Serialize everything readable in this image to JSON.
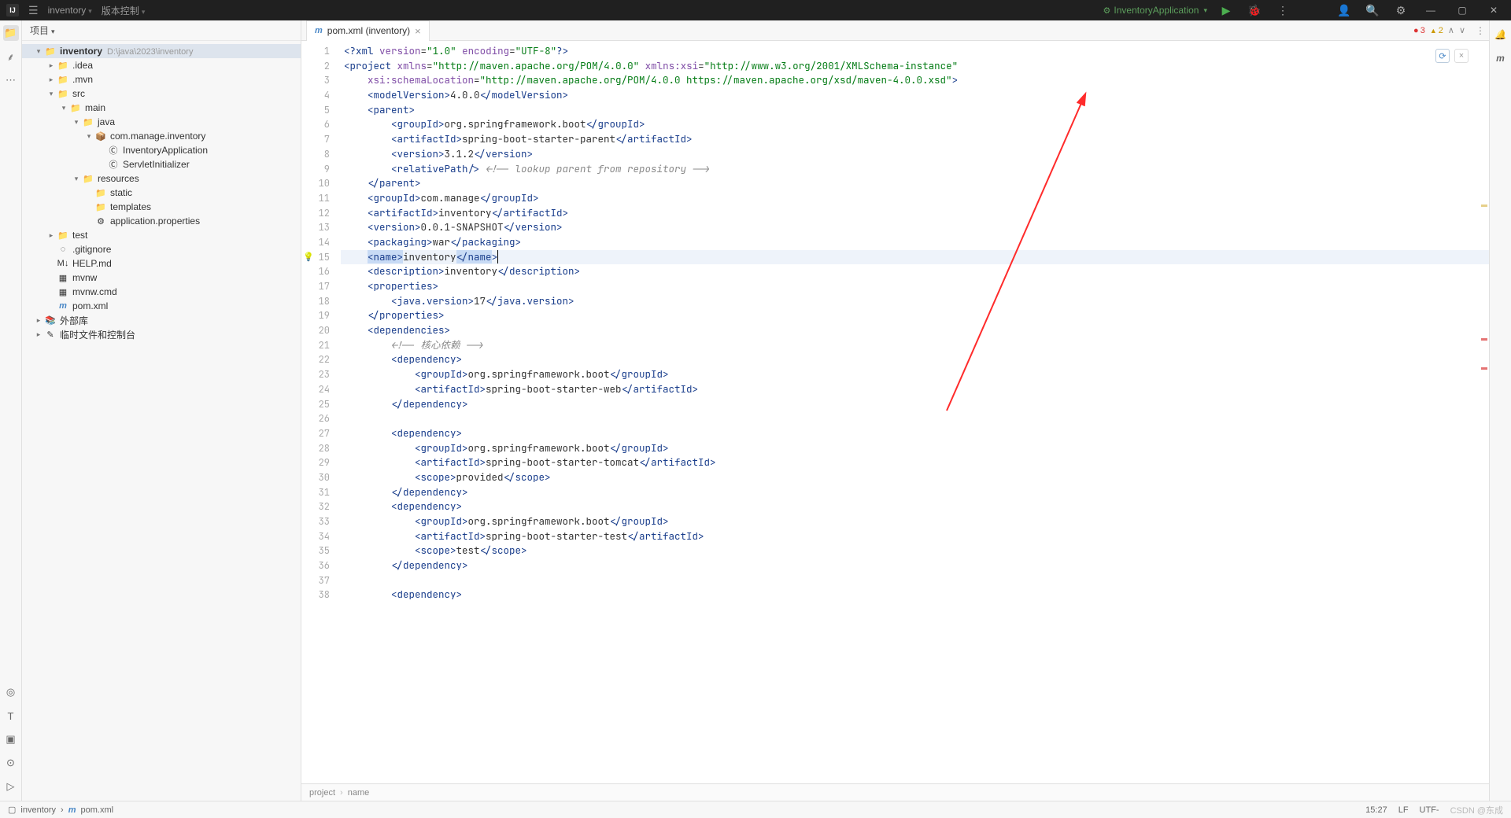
{
  "titlebar": {
    "project": "inventory",
    "vcs": "版本控制",
    "run_config": "InventoryApplication"
  },
  "panel": {
    "title": "项目"
  },
  "tree": [
    {
      "d": 0,
      "a": "▾",
      "i": "📁",
      "label": "inventory",
      "path": "D:\\java\\2023\\inventory",
      "sel": true,
      "bold": true
    },
    {
      "d": 1,
      "a": "▸",
      "i": "📁",
      "label": ".idea"
    },
    {
      "d": 1,
      "a": "▸",
      "i": "📁",
      "label": ".mvn"
    },
    {
      "d": 1,
      "a": "▾",
      "i": "📁",
      "label": "src"
    },
    {
      "d": 2,
      "a": "▾",
      "i": "📁",
      "label": "main"
    },
    {
      "d": 3,
      "a": "▾",
      "i": "📁",
      "label": "java"
    },
    {
      "d": 4,
      "a": "▾",
      "i": "📦",
      "label": "com.manage.inventory"
    },
    {
      "d": 5,
      "a": "",
      "i": "Ⓒ",
      "label": "InventoryApplication"
    },
    {
      "d": 5,
      "a": "",
      "i": "Ⓒ",
      "label": "ServletInitializer"
    },
    {
      "d": 3,
      "a": "▾",
      "i": "📁",
      "label": "resources"
    },
    {
      "d": 4,
      "a": "",
      "i": "📁",
      "label": "static"
    },
    {
      "d": 4,
      "a": "",
      "i": "📁",
      "label": "templates"
    },
    {
      "d": 4,
      "a": "",
      "i": "⚙",
      "label": "application.properties"
    },
    {
      "d": 1,
      "a": "▸",
      "i": "📁",
      "label": "test"
    },
    {
      "d": 1,
      "a": "",
      "i": "◌",
      "label": ".gitignore"
    },
    {
      "d": 1,
      "a": "",
      "i": "M↓",
      "label": "HELP.md"
    },
    {
      "d": 1,
      "a": "",
      "i": "▦",
      "label": "mvnw"
    },
    {
      "d": 1,
      "a": "",
      "i": "▦",
      "label": "mvnw.cmd"
    },
    {
      "d": 1,
      "a": "",
      "i": "m",
      "label": "pom.xml",
      "mi": true
    },
    {
      "d": 0,
      "a": "▸",
      "i": "📚",
      "label": "外部库"
    },
    {
      "d": 0,
      "a": "▸",
      "i": "✎",
      "label": "临时文件和控制台"
    }
  ],
  "tab": {
    "label": "pom.xml (inventory)"
  },
  "inspections": {
    "errors": "3",
    "warnings": "2"
  },
  "breadcrumb": [
    "project",
    "name"
  ],
  "statusbar": {
    "path": [
      "inventory",
      "pom.xml"
    ],
    "pos": "15:27",
    "eol": "LF",
    "enc": "UTF-",
    "watermark": "CSDN @东成"
  },
  "code": [
    {
      "n": 1,
      "html": "<span class='tag'>&lt;?xml</span> <span class='attr'>version</span>=<span class='str'>\"1.0\"</span> <span class='attr'>encoding</span>=<span class='str'>\"UTF-8\"</span><span class='tag'>?&gt;</span>"
    },
    {
      "n": 2,
      "html": "<span class='tag'>&lt;project</span> <span class='attr'>xmlns</span>=<span class='str'>\"http://maven.apache.org/POM/4.0.0\"</span> <span class='attr'>xmlns:xsi</span>=<span class='str'>\"http://www.w3.org/2001/XMLSchema-instance\"</span>"
    },
    {
      "n": 3,
      "html": "    <span class='attr'>xsi:schemaLocation</span>=<span class='str'>\"http://maven.apache.org/POM/4.0.0 https://maven.apache.org/xsd/maven-4.0.0.xsd\"</span><span class='tag'>&gt;</span>"
    },
    {
      "n": 4,
      "html": "    <span class='tag'>&lt;modelVersion&gt;</span><span class='txt'>4.0.0</span><span class='tag'>&lt;/modelVersion&gt;</span>"
    },
    {
      "n": 5,
      "html": "    <span class='tag'>&lt;parent&gt;</span>"
    },
    {
      "n": 6,
      "html": "        <span class='tag'>&lt;groupId&gt;</span><span class='txt'>org.springframework.boot</span><span class='tag'>&lt;/groupId&gt;</span>"
    },
    {
      "n": 7,
      "html": "        <span class='tag'>&lt;artifactId&gt;</span><span class='txt'>spring-boot-starter-parent</span><span class='tag'>&lt;/artifactId&gt;</span>"
    },
    {
      "n": 8,
      "html": "        <span class='tag'>&lt;version&gt;</span><span class='txt'>3.1.2</span><span class='tag'>&lt;/version&gt;</span>"
    },
    {
      "n": 9,
      "html": "        <span class='tag'>&lt;relativePath/&gt;</span> <span class='cmt'>&lt;!-- lookup parent from repository --&gt;</span>"
    },
    {
      "n": 10,
      "html": "    <span class='tag'>&lt;/parent&gt;</span>"
    },
    {
      "n": 11,
      "html": "    <span class='tag'>&lt;groupId&gt;</span><span class='txt'>com.manage</span><span class='tag'>&lt;/groupId&gt;</span>"
    },
    {
      "n": 12,
      "html": "    <span class='tag'>&lt;artifactId&gt;</span><span class='txt'>inventory</span><span class='tag'>&lt;/artifactId&gt;</span>"
    },
    {
      "n": 13,
      "html": "    <span class='tag'>&lt;version&gt;</span><span class='txt'>0.0.1-SNAPSHOT</span><span class='tag'>&lt;/version&gt;</span>"
    },
    {
      "n": 14,
      "html": "    <span class='tag'>&lt;packaging&gt;</span><span class='txt'>war</span><span class='tag'>&lt;/packaging&gt;</span>"
    },
    {
      "n": 15,
      "hl": true,
      "bulb": true,
      "html": "    <span class='sel'><span class='tag'>&lt;name&gt;</span></span><span class='txt'>inventory</span><span class='sel'><span class='tag'>&lt;/name</span></span><span class='tag'>&gt;</span><span class='caret'></span>"
    },
    {
      "n": 16,
      "html": "    <span class='tag'>&lt;description&gt;</span><span class='txt'>inventory</span><span class='tag'>&lt;/description&gt;</span>"
    },
    {
      "n": 17,
      "html": "    <span class='tag'>&lt;properties&gt;</span>"
    },
    {
      "n": 18,
      "html": "        <span class='tag'>&lt;java.version&gt;</span><span class='txt'>17</span><span class='tag'>&lt;/java.version&gt;</span>"
    },
    {
      "n": 19,
      "html": "    <span class='tag'>&lt;/properties&gt;</span>"
    },
    {
      "n": 20,
      "html": "    <span class='tag'>&lt;dependencies&gt;</span>"
    },
    {
      "n": 21,
      "html": "        <span class='cmt'>&lt;!-- 核心依赖 --&gt;</span>"
    },
    {
      "n": 22,
      "html": "        <span class='tag'>&lt;dependency&gt;</span>"
    },
    {
      "n": 23,
      "html": "            <span class='tag'>&lt;groupId&gt;</span><span class='txt'>org.springframework.boot</span><span class='tag'>&lt;/groupId&gt;</span>"
    },
    {
      "n": 24,
      "html": "            <span class='tag'>&lt;artifactId&gt;</span><span class='txt'>spring-boot-starter-web</span><span class='tag'>&lt;/artifactId&gt;</span>"
    },
    {
      "n": 25,
      "html": "        <span class='tag'>&lt;/dependency&gt;</span>"
    },
    {
      "n": 26,
      "html": ""
    },
    {
      "n": 27,
      "html": "        <span class='tag'>&lt;dependency&gt;</span>"
    },
    {
      "n": 28,
      "html": "            <span class='tag'>&lt;groupId&gt;</span><span class='txt'>org.springframework.boot</span><span class='tag'>&lt;/groupId&gt;</span>"
    },
    {
      "n": 29,
      "html": "            <span class='tag'>&lt;artifactId&gt;</span><span class='txt'>spring-boot-starter-tomcat</span><span class='tag'>&lt;/artifactId&gt;</span>"
    },
    {
      "n": 30,
      "html": "            <span class='tag'>&lt;scope&gt;</span><span class='txt'>provided</span><span class='tag'>&lt;/scope&gt;</span>"
    },
    {
      "n": 31,
      "html": "        <span class='tag'>&lt;/dependency&gt;</span>"
    },
    {
      "n": 32,
      "html": "        <span class='tag'>&lt;dependency&gt;</span>"
    },
    {
      "n": 33,
      "html": "            <span class='tag'>&lt;groupId&gt;</span><span class='txt'>org.springframework.boot</span><span class='tag'>&lt;/groupId&gt;</span>"
    },
    {
      "n": 34,
      "html": "            <span class='tag'>&lt;artifactId&gt;</span><span class='txt'>spring-boot-starter-test</span><span class='tag'>&lt;/artifactId&gt;</span>"
    },
    {
      "n": 35,
      "html": "            <span class='tag'>&lt;scope&gt;</span><span class='txt'>test</span><span class='tag'>&lt;/scope&gt;</span>"
    },
    {
      "n": 36,
      "html": "        <span class='tag'>&lt;/dependency&gt;</span>"
    },
    {
      "n": 37,
      "html": ""
    },
    {
      "n": 38,
      "html": "        <span class='tag'>&lt;dependency&gt;</span>"
    }
  ]
}
